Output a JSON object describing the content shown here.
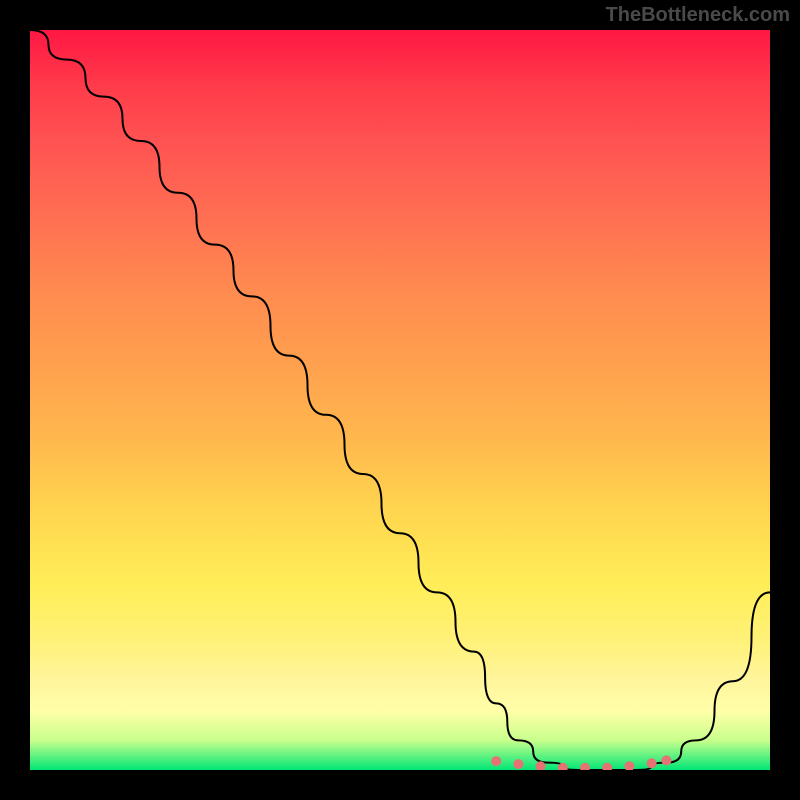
{
  "watermark": "TheBottleneck.com",
  "chart_data": {
    "type": "line",
    "title": "",
    "xlabel": "",
    "ylabel": "",
    "xlim": [
      0,
      100
    ],
    "ylim": [
      0,
      100
    ],
    "series": [
      {
        "name": "bottleneck-curve",
        "x": [
          0,
          5,
          10,
          15,
          20,
          25,
          30,
          35,
          40,
          45,
          50,
          55,
          60,
          63,
          66,
          70,
          74,
          78,
          82,
          86,
          90,
          95,
          100
        ],
        "values": [
          100,
          96,
          91,
          85,
          78,
          71,
          64,
          56,
          48,
          40,
          32,
          24,
          16,
          9,
          4,
          1,
          0,
          0,
          0,
          1,
          4,
          12,
          24
        ]
      }
    ],
    "markers": {
      "name": "optimal-range",
      "x": [
        63,
        66,
        69,
        72,
        75,
        78,
        81,
        84,
        86
      ],
      "values": [
        1.2,
        0.8,
        0.5,
        0.3,
        0.3,
        0.3,
        0.5,
        0.9,
        1.3
      ]
    },
    "gradient_stops": [
      {
        "pos": 0,
        "color": "#ff1744"
      },
      {
        "pos": 50,
        "color": "#ffb74d"
      },
      {
        "pos": 80,
        "color": "#ffee58"
      },
      {
        "pos": 100,
        "color": "#00e676"
      }
    ]
  }
}
